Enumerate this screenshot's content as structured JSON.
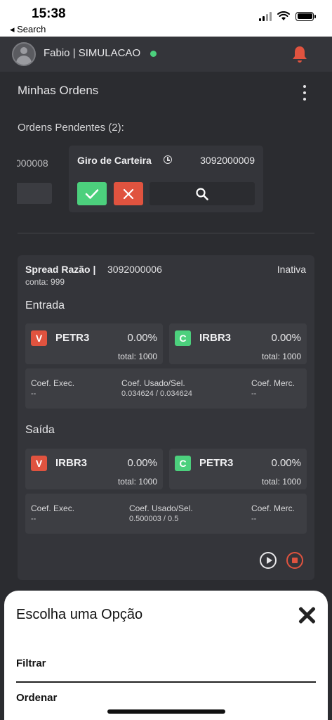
{
  "status_bar": {
    "time": "15:38",
    "back_label": "◂ Search"
  },
  "header": {
    "user": "Fabio | SIMULACAO",
    "online_color": "#4cd07d",
    "bell_color": "#e0533f"
  },
  "page": {
    "title": "Minhas Ordens",
    "pending_title": "Ordens Pendentes (2):"
  },
  "pending_orders": [
    {
      "id": "000008"
    },
    {
      "name": "Giro de Carteira",
      "id": "3092000009"
    }
  ],
  "strategy": {
    "name": "Spread Razão |",
    "id": "3092000006",
    "status": "Inativa",
    "account": "conta: 999",
    "entry": {
      "title": "Entrada",
      "legs": [
        {
          "side": "V",
          "ticker": "PETR3",
          "pct": "0.00%",
          "total": "total: 1000"
        },
        {
          "side": "C",
          "ticker": "IRBR3",
          "pct": "0.00%",
          "total": "total: 1000"
        }
      ],
      "coef": {
        "exec_label": "Coef. Exec.",
        "exec_value": "--",
        "used_label": "Coef. Usado/Sel.",
        "used_value": "0.034624 / 0.034624",
        "merc_label": "Coef. Merc.",
        "merc_value": "--"
      }
    },
    "exit": {
      "title": "Saída",
      "legs": [
        {
          "side": "V",
          "ticker": "IRBR3",
          "pct": "0.00%",
          "total": "total: 1000"
        },
        {
          "side": "C",
          "ticker": "PETR3",
          "pct": "0.00%",
          "total": "total: 1000"
        }
      ],
      "coef": {
        "exec_label": "Coef. Exec.",
        "exec_value": "--",
        "used_label": "Coef. Usado/Sel.",
        "used_value": "0.500003 / 0.5",
        "merc_label": "Coef. Merc.",
        "merc_value": "--"
      }
    }
  },
  "sheet": {
    "title": "Escolha uma Opção",
    "options": [
      "Filtrar",
      "Ordenar"
    ]
  }
}
